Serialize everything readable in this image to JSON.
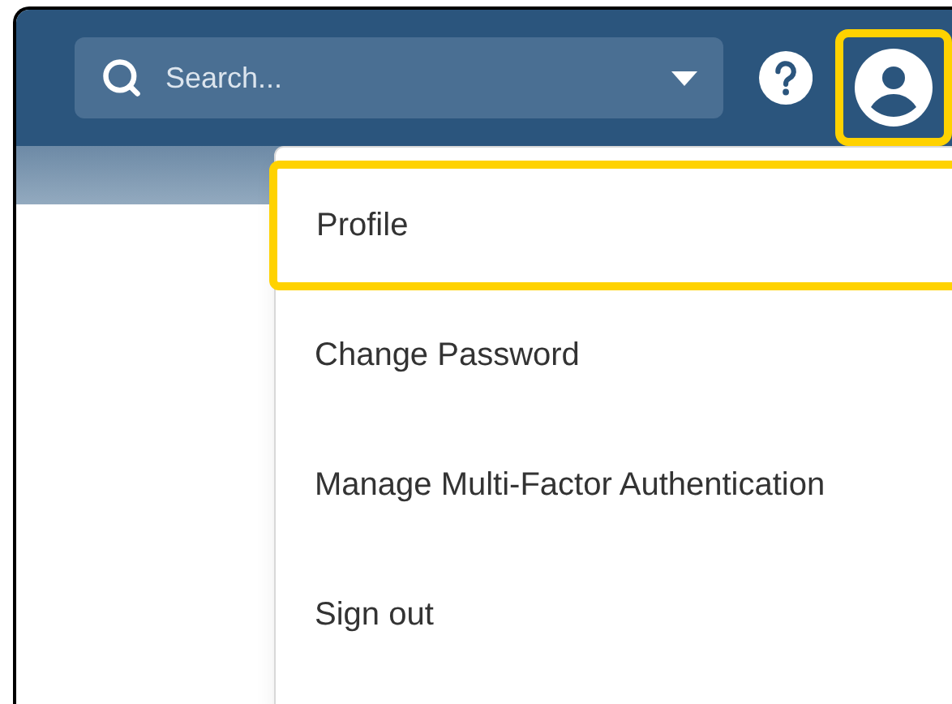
{
  "header": {
    "search": {
      "placeholder": "Search..."
    },
    "profile_button": {
      "highlighted": true
    }
  },
  "menu": [
    {
      "label": "Profile",
      "highlighted": true
    },
    {
      "label": "Change Password",
      "highlighted": false
    },
    {
      "label": "Manage Multi-Factor Authentication",
      "highlighted": false
    },
    {
      "label": "Sign out",
      "highlighted": false
    }
  ]
}
